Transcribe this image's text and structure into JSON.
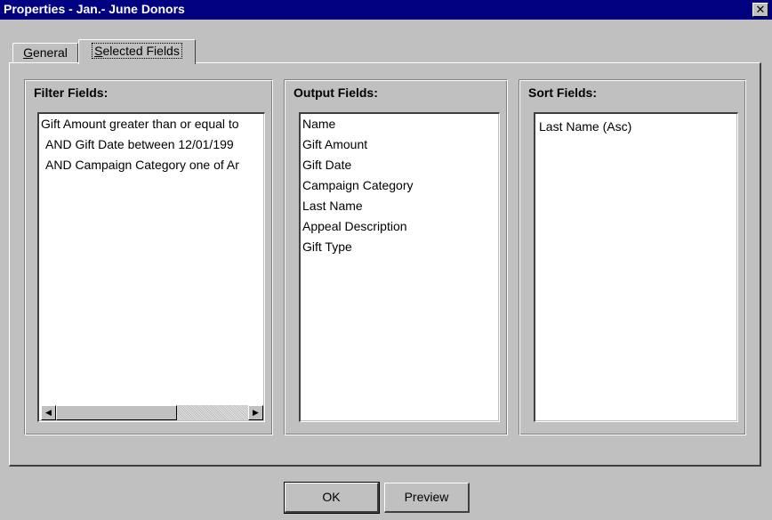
{
  "window": {
    "title": "Properties - Jan.- June Donors",
    "close_glyph": "✕"
  },
  "tabs": [
    {
      "label": "General",
      "mnemonic": "G",
      "rest": "eneral",
      "active": false
    },
    {
      "label": "Selected Fields",
      "mnemonic": "S",
      "rest": "elected Fields",
      "active": true
    }
  ],
  "filter": {
    "title": "Filter Fields:",
    "items": [
      "Gift Amount greater than or equal to",
      "AND Gift Date between 12/01/199",
      "AND Campaign Category one of Ar"
    ],
    "scroll_left_glyph": "◀",
    "scroll_right_glyph": "▶"
  },
  "output": {
    "title": "Output Fields:",
    "items": [
      "Name",
      "Gift Amount",
      "Gift Date",
      "Campaign Category",
      "Last Name",
      "Appeal Description",
      "Gift Type"
    ]
  },
  "sort": {
    "title": "Sort Fields:",
    "items": [
      "Last Name (Asc)"
    ]
  },
  "buttons": {
    "ok": "OK",
    "preview": "Preview"
  }
}
